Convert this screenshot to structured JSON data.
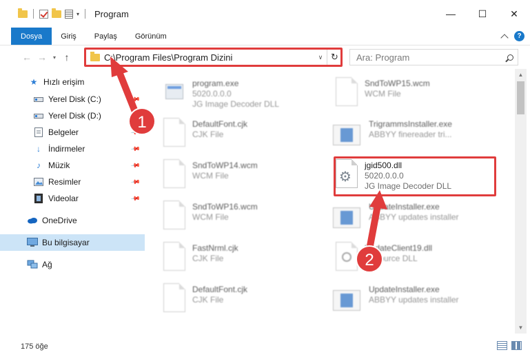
{
  "window": {
    "title": "Program",
    "controls": [
      "minimize-icon",
      "maximize-icon",
      "close-icon"
    ]
  },
  "ribbon": {
    "tabs": [
      {
        "label": "Dosya",
        "active": true
      },
      {
        "label": "Giriş"
      },
      {
        "label": "Paylaş"
      },
      {
        "label": "Görünüm"
      }
    ],
    "help_label": "?"
  },
  "address": {
    "path": "C:\\Program Files\\Program Dizini"
  },
  "search": {
    "placeholder": "Ara: Program"
  },
  "sidebar": {
    "items": [
      {
        "label": "Hızlı erişim",
        "icon": "star-icon",
        "pinned": false
      },
      {
        "label": "Yerel Disk (C:)",
        "icon": "disk-icon",
        "pinned": true
      },
      {
        "label": "Yerel Disk (D:)",
        "icon": "disk-icon",
        "pinned": true
      },
      {
        "label": "Belgeler",
        "icon": "document-icon",
        "pinned": true
      },
      {
        "label": "İndirmeler",
        "icon": "download-icon",
        "pinned": true
      },
      {
        "label": "Müzik",
        "icon": "music-icon",
        "pinned": true
      },
      {
        "label": "Resimler",
        "icon": "pictures-icon",
        "pinned": true
      },
      {
        "label": "Videolar",
        "icon": "video-icon",
        "pinned": true
      },
      {
        "label": "OneDrive",
        "icon": "cloud-icon",
        "pinned": false
      },
      {
        "label": "Bu bilgisayar",
        "icon": "computer-icon",
        "pinned": false,
        "selected": true
      },
      {
        "label": "Ağ",
        "icon": "network-icon",
        "pinned": false
      }
    ]
  },
  "files": [
    {
      "name": "program.exe",
      "line2": "5020.0.0.0",
      "line3": "JG Image Decoder DLL",
      "icon": "exe"
    },
    {
      "name": "SndToWP15.wcm",
      "line2": "WCM File",
      "line3": "",
      "icon": "file"
    },
    {
      "name": "DefaultFont.cjk",
      "line2": "CJK File",
      "line3": "",
      "icon": "file"
    },
    {
      "name": "TrigrammsInstaller.exe",
      "line2": "ABBYY finereader tri...",
      "line3": "",
      "icon": "app"
    },
    {
      "name": "SndToWP14.wcm",
      "line2": "WCM File",
      "line3": "",
      "icon": "file"
    },
    {
      "name": "jgid500.dll",
      "line2": "5020.0.0.0",
      "line3": "JG Image Decoder DLL",
      "icon": "gear"
    },
    {
      "name": "SndToWP16.wcm",
      "line2": "WCM File",
      "line3": "",
      "icon": "file"
    },
    {
      "name": "UpdateInstaller.exe",
      "line2": "ABBYY updates installer",
      "line3": "",
      "icon": "app"
    },
    {
      "name": "FastNrml.cjk",
      "line2": "CJK File",
      "line3": "",
      "icon": "file"
    },
    {
      "name": "UpdateClient19.dll",
      "line2": "Resource DLL",
      "line3": "",
      "icon": "mag"
    },
    {
      "name": "DefaultFont.cjk",
      "line2": "CJK File",
      "line3": "",
      "icon": "file"
    },
    {
      "name": "UpdateInstaller.exe",
      "line2": "ABBYY updates installer",
      "line3": "",
      "icon": "app"
    }
  ],
  "status": {
    "count": "175 öğe"
  },
  "annotations": {
    "step1": "1",
    "step2": "2",
    "color": "#e03c3c"
  }
}
